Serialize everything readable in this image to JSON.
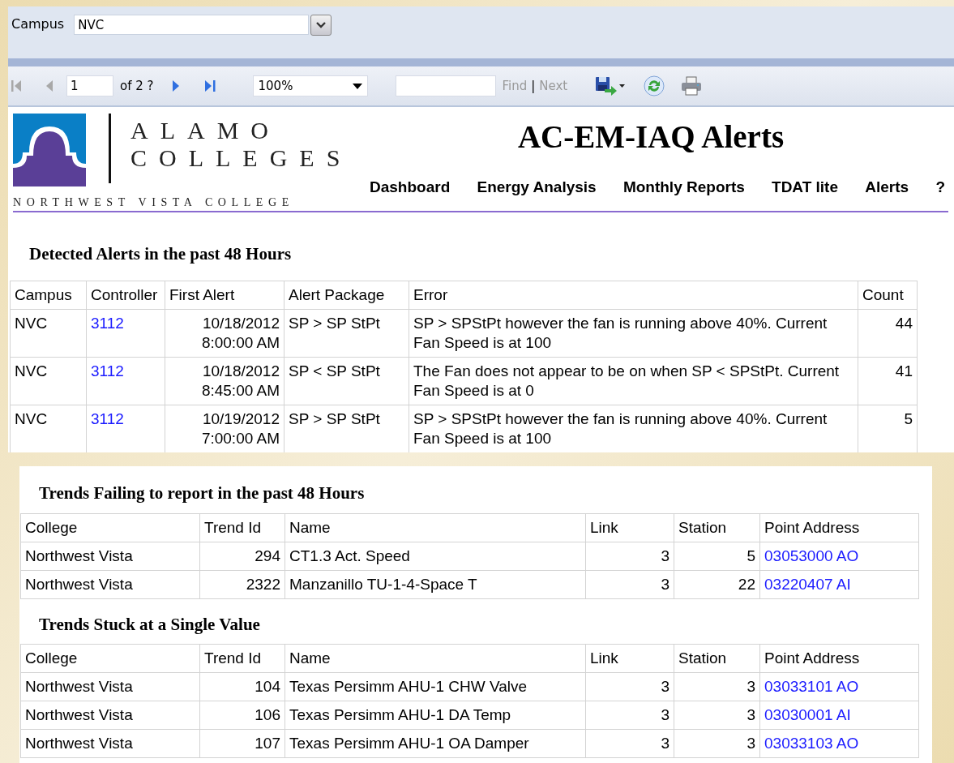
{
  "parameters": {
    "label": "Campus",
    "value": "NVC"
  },
  "toolbar": {
    "back_buttons": [
      {
        "kind": "first",
        "disabled": true
      },
      {
        "kind": "previous",
        "disabled": true
      }
    ],
    "page": "1",
    "page_count": "of 2 ?",
    "forward_buttons": [
      {
        "kind": "next",
        "disabled": false
      },
      {
        "kind": "last",
        "disabled": false
      }
    ],
    "zoom": "100%",
    "find_links": [
      {
        "label": "Find",
        "disabled": true
      },
      {
        "label": "Next",
        "disabled": true
      }
    ],
    "find_separator": "|"
  },
  "logo": {
    "line1": "ALAMO",
    "line2": "COLLEGES",
    "subtitle": "NORTHWEST VISTA COLLEGE"
  },
  "title": "AC-EM-IAQ Alerts",
  "nav": [
    "Dashboard",
    "Energy Analysis",
    "Monthly Reports",
    "TDAT lite",
    "Alerts",
    "?"
  ],
  "alerts": {
    "heading": "Detected Alerts in the past 48 Hours",
    "columns": [
      {
        "label": "Campus",
        "kind": "text"
      },
      {
        "label": "Controller",
        "kind": "link"
      },
      {
        "label": "First Alert",
        "kind": "number"
      },
      {
        "label": "Alert Package",
        "kind": "text"
      },
      {
        "label": "Error",
        "kind": "text"
      },
      {
        "label": "Count",
        "kind": "number"
      }
    ],
    "rows": [
      [
        "NVC",
        "3112",
        "10/18/2012 8:00:00 AM",
        "SP > SP StPt",
        "SP > SPStPt however the fan is running above 40%. Current Fan Speed is at 100",
        "44"
      ],
      [
        "NVC",
        "3112",
        "10/18/2012 8:45:00 AM",
        "SP < SP StPt",
        "The Fan does not appear to be on when SP < SPStPt. Current Fan Speed is at 0",
        "41"
      ],
      [
        "NVC",
        "3112",
        "10/19/2012 7:00:00 AM",
        "SP > SP StPt",
        "SP > SPStPt however the fan is running above 40%. Current Fan Speed is at 100",
        "5"
      ]
    ]
  },
  "failing_trends": {
    "heading": "Trends Failing to report in the past 48 Hours",
    "columns": [
      {
        "label": "College",
        "kind": "text"
      },
      {
        "label": "Trend Id",
        "kind": "number"
      },
      {
        "label": "Name",
        "kind": "text"
      },
      {
        "label": "Link",
        "kind": "number"
      },
      {
        "label": "Station",
        "kind": "number"
      },
      {
        "label": "Point Address",
        "kind": "link"
      }
    ],
    "rows": [
      [
        "Northwest Vista",
        "294",
        "CT1.3 Act. Speed",
        "3",
        "5",
        "03053000 AO"
      ],
      [
        "Northwest Vista",
        "2322",
        "Manzanillo TU-1-4-Space T",
        "3",
        "22",
        "03220407 AI"
      ]
    ]
  },
  "stuck_trends": {
    "heading": "Trends Stuck at a Single Value",
    "columns": [
      {
        "label": "College",
        "kind": "text"
      },
      {
        "label": "Trend Id",
        "kind": "number"
      },
      {
        "label": "Name",
        "kind": "text"
      },
      {
        "label": "Link",
        "kind": "number"
      },
      {
        "label": "Station",
        "kind": "number"
      },
      {
        "label": "Point Address",
        "kind": "link"
      }
    ],
    "rows": [
      [
        "Northwest Vista",
        "104",
        "Texas Persimm AHU-1 CHW Valve",
        "3",
        "3",
        "03033101 AO"
      ],
      [
        "Northwest Vista",
        "106",
        "Texas Persimm AHU-1 DA Temp",
        "3",
        "3",
        "03030001 AI"
      ],
      [
        "Northwest Vista",
        "107",
        "Texas Persimm AHU-1 OA Damper",
        "3",
        "3",
        "03033103 AO"
      ]
    ]
  }
}
